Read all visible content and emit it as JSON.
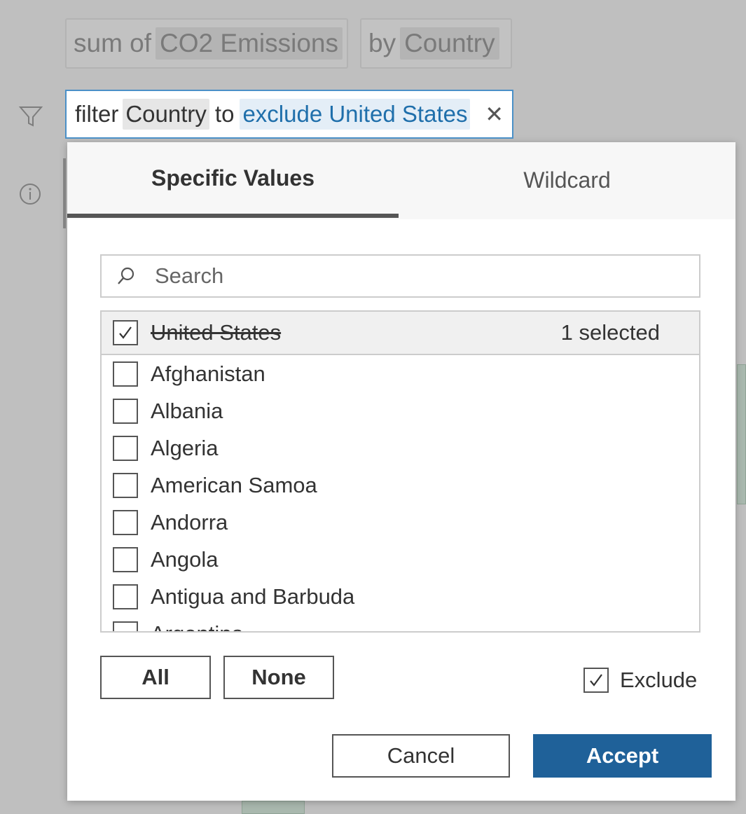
{
  "pills": [
    {
      "prefix": "sum of",
      "field": "CO2 Emissions"
    },
    {
      "prefix": "by",
      "field": "Country"
    }
  ],
  "filter": {
    "word_filter": "filter",
    "field": "Country",
    "word_to": "to",
    "value": "exclude United States",
    "clear_icon": "close-icon"
  },
  "tabs": [
    {
      "label": "Specific Values",
      "active": true
    },
    {
      "label": "Wildcard",
      "active": false
    }
  ],
  "search": {
    "placeholder": "Search",
    "value": ""
  },
  "selected_header": {
    "label": "United States",
    "checked": true,
    "count_text": "1 selected"
  },
  "countries": [
    {
      "label": "Afghanistan",
      "checked": false
    },
    {
      "label": "Albania",
      "checked": false
    },
    {
      "label": "Algeria",
      "checked": false
    },
    {
      "label": "American Samoa",
      "checked": false
    },
    {
      "label": "Andorra",
      "checked": false
    },
    {
      "label": "Angola",
      "checked": false
    },
    {
      "label": "Antigua and Barbuda",
      "checked": false
    },
    {
      "label": "Argentina",
      "checked": false
    }
  ],
  "buttons": {
    "all": "All",
    "none": "None",
    "cancel": "Cancel",
    "accept": "Accept"
  },
  "exclude": {
    "label": "Exclude",
    "checked": true
  },
  "colors": {
    "accent": "#1f6199",
    "link": "#1f6fab",
    "focus_border": "#4a90c7"
  },
  "icons": [
    "filter-icon",
    "info-icon",
    "search-icon",
    "close-icon",
    "checkmark-icon"
  ]
}
